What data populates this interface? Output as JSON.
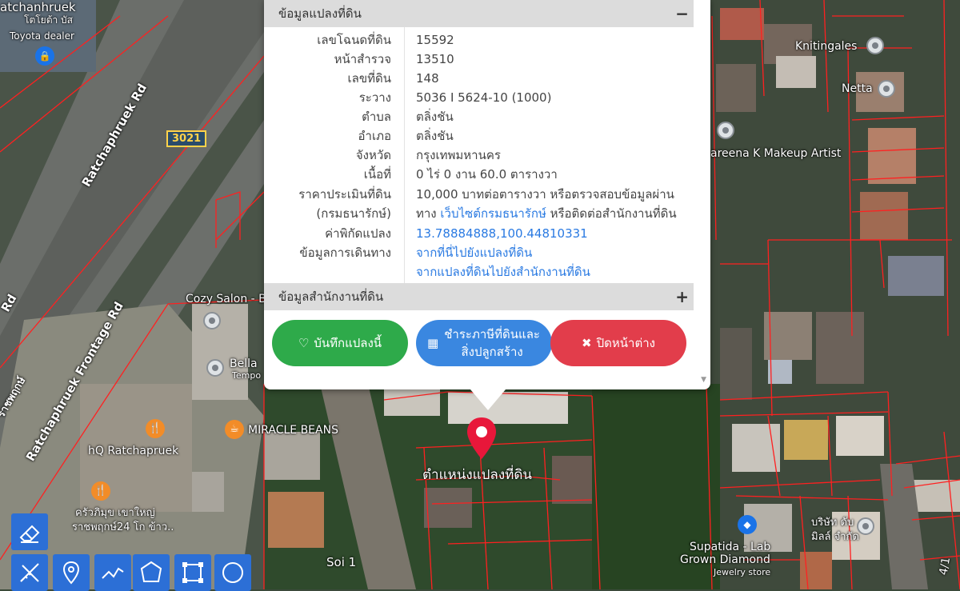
{
  "map": {
    "labels": {
      "top_left": "atchanhruek",
      "thai_toyota": "โตโยต้า บัส",
      "toyota": "Toyota dealer",
      "ratchaphruek_rd": "Ratchaphruek Rd",
      "road_shield": "3021",
      "frontage_rd": "Ratchaphruek Frontage Rd",
      "rd_left": "Rd",
      "thai_left": "ราชพฤกษ์",
      "cozy_salon": "Cozy Salon - B",
      "bella": "Bella",
      "tempo": "Tempo",
      "miracle": "MIRACLE BEANS",
      "hq": "hQ Ratchapruek",
      "thai_restaurant1": "ครัวภิมุข เขาใหญ่",
      "thai_restaurant2": "ราชพฤกษ์24 โก ข้าว..",
      "soi1": "Soi 1",
      "knitingales": "Knitingales",
      "netta": "Netta",
      "sareena": "areena K Makeup Artist",
      "supatida1": "Supatida - Lab",
      "supatida2": "Grown Diamond",
      "supatida3": "Jewelry store",
      "company1": "บริษัท ดับ",
      "company2": "มิลล์ จำกัด",
      "corner": "4/1",
      "marker_label": "ตำแหน่งแปลงที่ดิน"
    }
  },
  "popup": {
    "section1_title": "ข้อมูลแปลงที่ดิน",
    "section1_toggle": "−",
    "rows": [
      {
        "key": "เลขโฉนดที่ดิน",
        "value": "15592"
      },
      {
        "key": "หน้าสำรวจ",
        "value": "13510"
      },
      {
        "key": "เลขที่ดิน",
        "value": "148"
      },
      {
        "key": "ระวาง",
        "value": "5036 I 5624-10 (1000)"
      },
      {
        "key": "ตำบล",
        "value": "ตลิ่งชัน"
      },
      {
        "key": "อำเภอ",
        "value": "ตลิ่งชัน"
      },
      {
        "key": "จังหวัด",
        "value": "กรุงเทพมหานคร"
      },
      {
        "key": "เนื้อที่",
        "value": "0 ไร่ 0 งาน 60.0 ตารางวา"
      }
    ],
    "price_key1": "ราคาประเมินที่ดิน",
    "price_key2": "(กรมธนารักษ์)",
    "price_val1": "10,000 บาทต่อตารางวา หรือตรวจสอบข้อมูลผ่าน",
    "price_val2_pre": "ทาง ",
    "price_val2_link": "เว็บไซต์กรมธนารักษ์",
    "price_val2_post": " หรือติดต่อสำนักงานที่ดิน",
    "coord_key": "ค่าพิกัดแปลง",
    "coord_val": "13.78884888,100.44810331",
    "travel_key": "ข้อมูลการเดินทาง",
    "travel_link1": "จากที่นี่ไปยังแปลงที่ดิน",
    "travel_link2": "จากแปลงที่ดินไปยังสำนักงานที่ดิน",
    "section2_title": "ข้อมูลสำนักงานที่ดิน",
    "section2_toggle": "+",
    "btn_save": "บันทึกแปลงนี้",
    "btn_tax": "ชำระภาษีที่ดินและสิ่งปลูกสร้าง",
    "btn_close": "ปิดหน้าต่าง"
  },
  "colors": {
    "save": "#2eaa4a",
    "tax": "#3a87e0",
    "close": "#e23d4b",
    "parcel_line": "#ff2020",
    "marker": "#e8173a"
  },
  "tools": [
    {
      "name": "eraser-icon"
    },
    {
      "name": "ruler-icon"
    },
    {
      "name": "pin-icon"
    },
    {
      "name": "polyline-icon"
    },
    {
      "name": "polygon-icon"
    },
    {
      "name": "rectangle-icon"
    },
    {
      "name": "circle-icon"
    }
  ]
}
